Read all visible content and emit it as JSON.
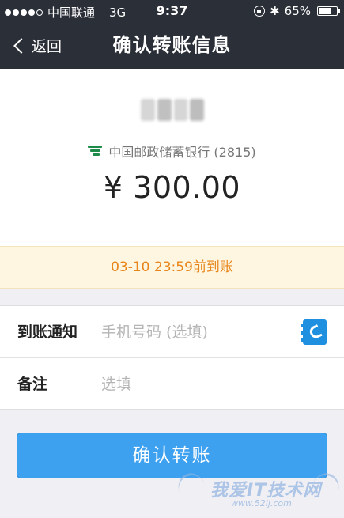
{
  "status_bar": {
    "signal_dots_filled": 4,
    "signal_dots_total": 5,
    "carrier": "中国联通",
    "network": "3G",
    "time": "9:37",
    "battery_text": "65%",
    "battery_level": 0.65,
    "icons": [
      "lock-rotation-icon",
      "bluetooth-icon",
      "battery-icon"
    ]
  },
  "navbar": {
    "back_label": "返回",
    "title": "确认转账信息"
  },
  "payee": {
    "bank_name": "中国邮政储蓄银行 (2815)",
    "amount": "¥ 300.00",
    "bank_icon_color": "#1e8b4a"
  },
  "notice": {
    "text": "03-10 23:59前到账",
    "color": "#e8851a"
  },
  "form": {
    "notify_label": "到账通知",
    "notify_placeholder": "手机号码 (选填)",
    "remark_label": "备注",
    "remark_placeholder": "选填"
  },
  "confirm_button": {
    "label": "确认转账",
    "color": "#3ea1f0"
  },
  "watermark": {
    "text": "我爱IT技术网",
    "url": "www.52ij.com"
  }
}
